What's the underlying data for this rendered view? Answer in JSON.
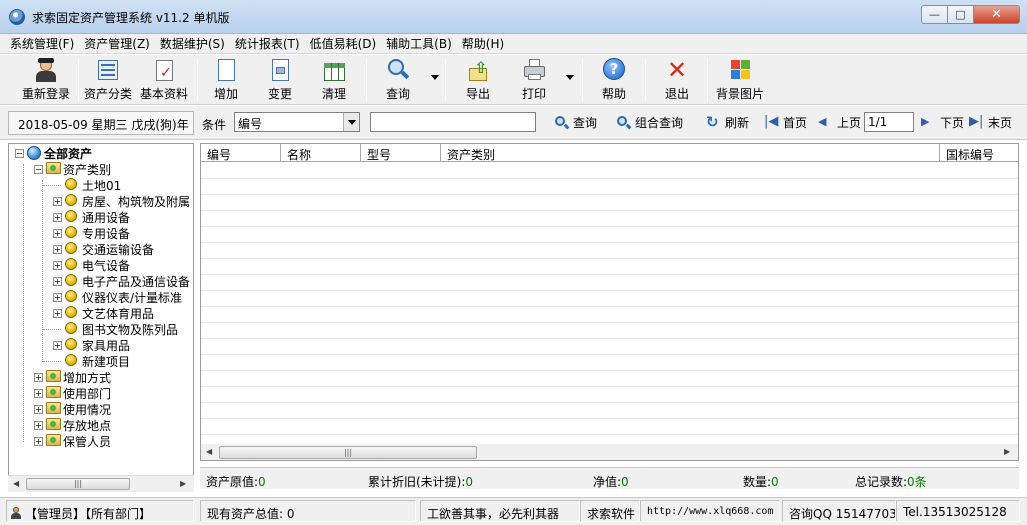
{
  "window": {
    "title": "求索固定资产管理系统 v11.2 单机版"
  },
  "menu": [
    "系统管理(F)",
    "资产管理(Z)",
    "数据维护(S)",
    "统计报表(T)",
    "低值易耗(D)",
    "辅助工具(B)",
    "帮助(H)"
  ],
  "toolbar": {
    "relogin": "重新登录",
    "category": "资产分类",
    "basic": "基本资料",
    "add": "增加",
    "change": "变更",
    "clear": "清理",
    "query": "查询",
    "export": "导出",
    "print": "打印",
    "help": "帮助",
    "exit": "退出",
    "background": "背景图片"
  },
  "search": {
    "date": "2018-05-09 星期三 戊戌(狗)年",
    "condition_label": "条件",
    "condition_value": "编号",
    "keyword": "",
    "query": "查询",
    "combo_query": "组合查询",
    "refresh": "刷新",
    "first": "首页",
    "prev": "上页",
    "page": "1/1",
    "next": "下页",
    "last": "末页"
  },
  "tree": {
    "root": "全部资产",
    "category": "资产类别",
    "children": [
      "土地01",
      "房屋、构筑物及附属",
      "通用设备",
      "专用设备",
      "交通运输设备",
      "电气设备",
      "电子产品及通信设备",
      "仪器仪表/计量标准",
      "文艺体育用品",
      "图书文物及陈列品",
      "家具用品",
      "新建项目"
    ],
    "others": [
      "增加方式",
      "使用部门",
      "使用情况",
      "存放地点",
      "保管人员"
    ]
  },
  "grid": {
    "columns": [
      "编号",
      "名称",
      "型号",
      "资产类别",
      "国标编号"
    ]
  },
  "summary": {
    "original_label": "资产原值:",
    "original_value": "0",
    "depr_label": "累计折旧(未计提):",
    "depr_value": "0",
    "net_label": "净值:",
    "net_value": "0",
    "qty_label": "数量:",
    "qty_value": "0",
    "total_label": "总记录数:",
    "total_value": "0条"
  },
  "status": {
    "user": "【管理员】【所有部门】",
    "total": "现有资产总值: 0",
    "motto": "工欲善其事，必先利其器",
    "company": "求索软件",
    "url": "http://www.xlq668.com",
    "qq": "咨询QQ 151477039",
    "tel": "Tel.13513025128"
  },
  "colors": {
    "accent": "#1f5fa8",
    "green": "#008000"
  }
}
